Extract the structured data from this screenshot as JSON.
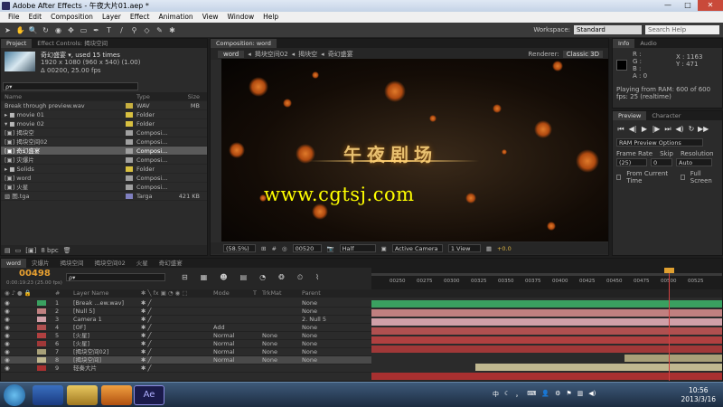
{
  "window": {
    "title": "Adobe After Effects - 午夜大片01.aep *",
    "min": "—",
    "max": "□",
    "close": "✕"
  },
  "menu": [
    "File",
    "Edit",
    "Composition",
    "Layer",
    "Effect",
    "Animation",
    "View",
    "Window",
    "Help"
  ],
  "toolbar": {
    "workspace_label": "Workspace:",
    "workspace_value": "Standard",
    "search_placeholder": "Search Help"
  },
  "project": {
    "tabs": [
      "Project",
      "Effect Controls: 揭块空间"
    ],
    "preview_name": "奇幻盛宴 ▾, used 15 times",
    "preview_info1": "1920 x 1080  (960 x 540) (1.00)",
    "preview_info2": "Δ 00200, 25.00 fps",
    "search_placeholder": "ρ▾",
    "headers": {
      "name": "Name",
      "type": "Type",
      "size": "Size"
    },
    "items": [
      {
        "name": "Break through preview.wav",
        "type": "WAV",
        "size": "MB",
        "color": "#c8b040"
      },
      {
        "name": "▸ ■ movie 01",
        "type": "Folder",
        "size": "",
        "color": "#d8c040"
      },
      {
        "name": "▾ ■ movie 02",
        "type": "Folder",
        "size": "",
        "color": "#d8c040"
      },
      {
        "name": "   [▣] 揭块空",
        "type": "Composi...",
        "size": "",
        "color": "#a0a0a0"
      },
      {
        "name": "   [▣] 揭块空间02",
        "type": "Composi...",
        "size": "",
        "color": "#a0a0a0"
      },
      {
        "name": "   [▣] 奇幻盛宴",
        "type": "Composi...",
        "size": "",
        "color": "#a0a0a0"
      },
      {
        "name": "   [▣] 灾爆片",
        "type": "Composi...",
        "size": "",
        "color": "#a0a0a0"
      },
      {
        "name": "▸ ■ Solids",
        "type": "Folder",
        "size": "",
        "color": "#d8c040"
      },
      {
        "name": "[▣] word",
        "type": "Composi...",
        "size": "",
        "color": "#a0a0a0"
      },
      {
        "name": "[▣] 火星",
        "type": "Composi...",
        "size": "",
        "color": "#a0a0a0"
      },
      {
        "name": "▧ 图.tga",
        "type": "Targa",
        "size": "421 KB",
        "color": "#8080c0"
      }
    ],
    "bpc": "8 bpc"
  },
  "composition": {
    "tab": "Composition: word",
    "breadcrumbs": [
      "word",
      "揭块空间02",
      "揭块空",
      "奇幻盛宴"
    ],
    "renderer_label": "Renderer:",
    "renderer_value": "Classic 3D",
    "title_text": "午夜剧场",
    "watermark": "www.cgtsj.com",
    "footer": {
      "zoom": "(58.5%)",
      "timecode": "00520",
      "resolution": "Half",
      "camera": "Active Camera",
      "views": "1 View",
      "exposure": "+0.0"
    }
  },
  "info": {
    "tabs": [
      "Info",
      "Audio"
    ],
    "r": "R :",
    "g": "G :",
    "b": "B :",
    "a": "A : 0",
    "x": "X : 1163",
    "y": "Y : 471",
    "ram": "Playing from RAM: 600 of 600",
    "fps": "fps: 25 (realtime)"
  },
  "preview": {
    "tabs": [
      "Preview",
      "Character"
    ],
    "ram_options": "RAM Preview Options",
    "frame_rate_label": "Frame Rate",
    "frame_rate": "(25)",
    "skip_label": "Skip",
    "skip": "0",
    "resolution_label": "Resolution",
    "resolution": "Auto",
    "from_current": "From Current Time",
    "full_screen": "Full Screen"
  },
  "timeline": {
    "tabs": [
      "word",
      "灾爆片",
      "揭块空间",
      "揭块空间02",
      "火星",
      "奇幻盛宴"
    ],
    "timecode": "00498",
    "subcode": "0:00:19:23 (25.00 fps)",
    "search_placeholder": "ρ▾",
    "headers": {
      "num": "#",
      "name": "Layer Name",
      "mode": "Mode",
      "t": "T",
      "trkmat": "TrkMat",
      "parent": "Parent"
    },
    "ruler": [
      "00250",
      "00275",
      "00300",
      "00325",
      "00350",
      "00375",
      "00400",
      "00425",
      "00450",
      "00475",
      "00500",
      "00525"
    ],
    "layers": [
      {
        "num": "1",
        "name": "[Break ...ew.wav]",
        "mode": "",
        "trkmat": "",
        "parent": "None",
        "color": "#3aa060"
      },
      {
        "num": "2",
        "name": "[Null 5]",
        "mode": "",
        "trkmat": "",
        "parent": "None",
        "color": "#c08080"
      },
      {
        "num": "3",
        "name": "Camera 1",
        "mode": "",
        "trkmat": "",
        "parent": "2. Null 5",
        "color": "#d0a0a8"
      },
      {
        "num": "4",
        "name": "[OF]",
        "mode": "Add",
        "trkmat": "",
        "parent": "None",
        "color": "#b05050"
      },
      {
        "num": "5",
        "name": "[火星]",
        "mode": "Normal",
        "trkmat": "None",
        "parent": "None",
        "color": "#b04040"
      },
      {
        "num": "6",
        "name": "[火星]",
        "mode": "Normal",
        "trkmat": "None",
        "parent": "None",
        "color": "#a03838"
      },
      {
        "num": "7",
        "name": "[揭块空间02]",
        "mode": "Normal",
        "trkmat": "None",
        "parent": "None",
        "color": "#a8a078"
      },
      {
        "num": "8",
        "name": "[揭块空间]",
        "mode": "Normal",
        "trkmat": "None",
        "parent": "None",
        "color": "#c0b890"
      },
      {
        "num": "9",
        "name": "轻奏大片",
        "mode": "",
        "trkmat": "",
        "parent": "",
        "color": "#a83030"
      }
    ]
  },
  "taskbar": {
    "time": "10:56",
    "date": "2013/3/16",
    "ae_label": "Ae"
  }
}
